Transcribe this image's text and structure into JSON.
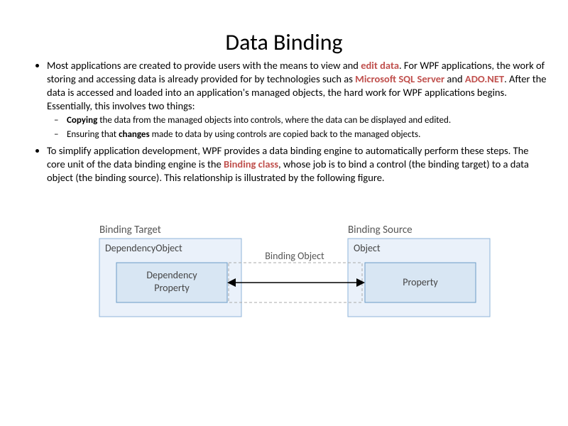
{
  "title": "Data Binding",
  "bullets": {
    "p1_a": "Most applications are created to provide users with the means to view and ",
    "p1_b": "edit data",
    "p1_c": ". For WPF applications, the work of storing and accessing data is already provided for by technologies such as ",
    "p1_d": "Microsoft SQL Server",
    "p1_e": " and ",
    "p1_f": "ADO.NET",
    "p1_g": ". After the data is accessed and loaded into an application's managed objects, the hard work for WPF applications begins. Essentially, this involves two things:",
    "s1_a": "Copying",
    "s1_b": " the data from the managed objects into controls, where the data can be displayed and edited.",
    "s2_a": "Ensuring that ",
    "s2_b": "changes",
    "s2_c": " made to data by using controls are copied back to the managed objects.",
    "p2_a": "To simplify application development, WPF provides a data binding engine to automatically perform these steps. The core unit of the data binding engine is the ",
    "p2_b": "Binding class",
    "p2_c": ", whose job is to bind a control (the binding target) to a data object (the binding source). This relationship is illustrated by the following figure."
  },
  "diagram": {
    "bindingTarget": "Binding Target",
    "dependencyObject": "DependencyObject",
    "dependencyProperty": "Dependency Property",
    "bindingObject": "Binding Object",
    "bindingSource": "Binding Source",
    "object": "Object",
    "property": "Property"
  }
}
